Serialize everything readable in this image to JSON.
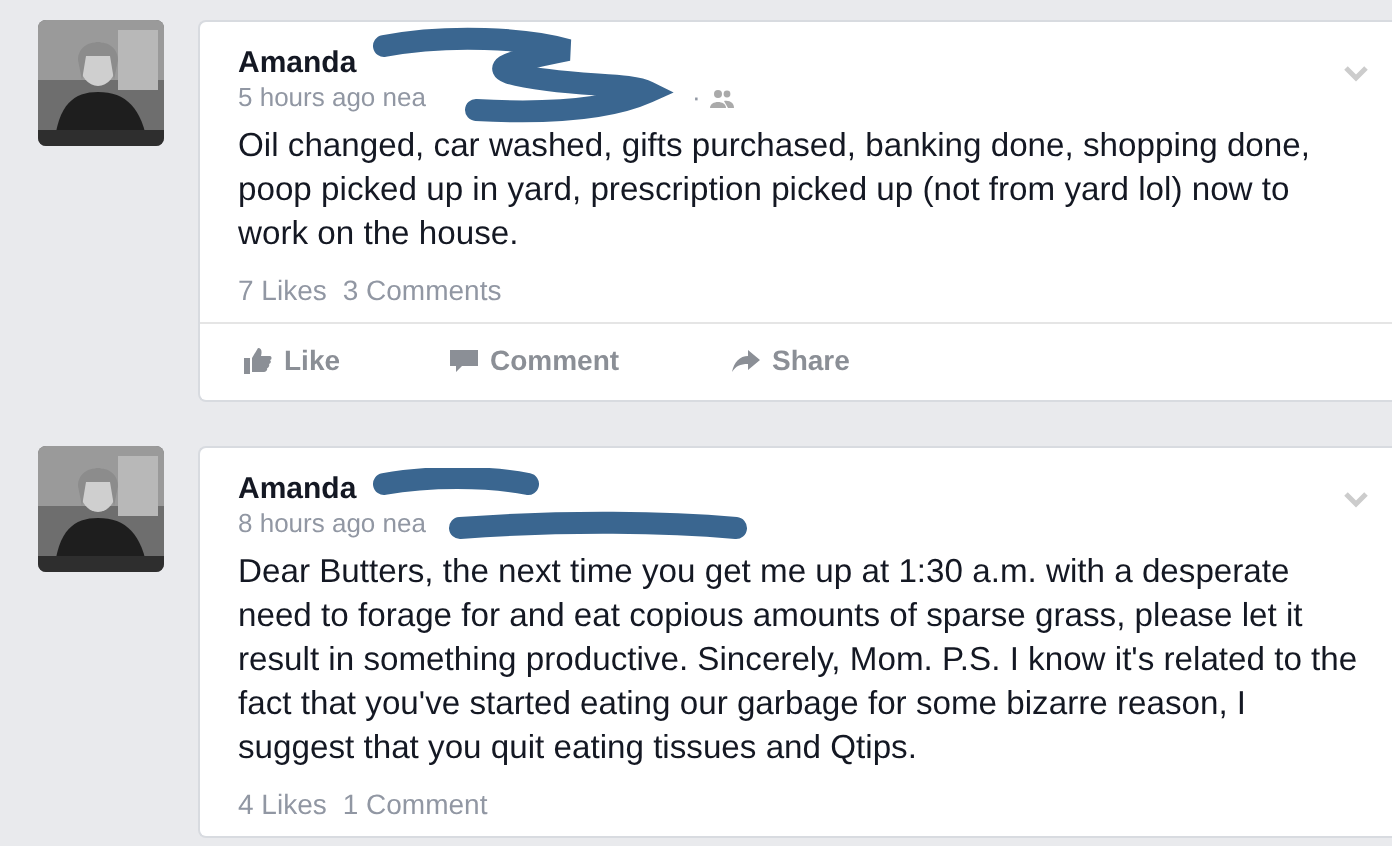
{
  "posts": [
    {
      "author": "Amanda",
      "meta": "5 hours ago nea",
      "meta_suffix": "·",
      "text": "Oil changed, car washed, gifts purchased, banking done, shopping done, poop picked up in yard, prescription picked up (not from yard lol) now to work on the house.",
      "likes": "7 Likes",
      "comments": "3 Comments",
      "actions": [
        {
          "kind": "like",
          "label": "Like"
        },
        {
          "kind": "comment",
          "label": "Comment"
        },
        {
          "kind": "share",
          "label": "Share"
        }
      ]
    },
    {
      "author": "Amanda",
      "meta": "8 hours ago nea",
      "text": "Dear Butters, the next time you get me up at 1:30 a.m. with a desperate need to forage for and eat copious amounts of sparse grass, please let it result in something productive. Sincerely, Mom.  P.S. I know it's related to the fact that you've started eating our garbage for some bizarre reason, I suggest that you quit eating tissues and Qtips.",
      "likes": "4 Likes",
      "comments": "1 Comment"
    }
  ]
}
